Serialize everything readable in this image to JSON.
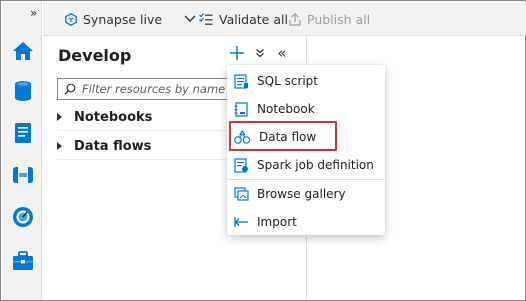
{
  "toolbar": {
    "workspace_label": "Synapse live",
    "validate_label": "Validate all",
    "publish_label": "Publish all"
  },
  "rail": {
    "expand_glyph": "»",
    "icons": [
      "home-icon",
      "data-icon",
      "develop-icon",
      "integrate-icon",
      "monitor-icon",
      "manage-icon"
    ]
  },
  "panel": {
    "title": "Develop",
    "add_glyph": "+",
    "collapse_glyph": "«",
    "search": {
      "placeholder": "Filter resources by name"
    },
    "tree": [
      {
        "label": "Notebooks"
      },
      {
        "label": "Data flows"
      }
    ]
  },
  "menu": {
    "items": [
      {
        "label": "SQL script",
        "icon": "sql-script-icon"
      },
      {
        "label": "Notebook",
        "icon": "notebook-icon"
      },
      {
        "label": "Data flow",
        "icon": "data-flow-icon",
        "highlighted": true
      },
      {
        "label": "Spark job definition",
        "icon": "spark-job-icon"
      },
      {
        "label": "Browse gallery",
        "icon": "gallery-icon"
      },
      {
        "label": "Import",
        "icon": "import-icon"
      }
    ]
  },
  "colors": {
    "accent": "#0078d4",
    "highlight_border": "#d13438",
    "rail_bg": "#f3f2f1"
  }
}
